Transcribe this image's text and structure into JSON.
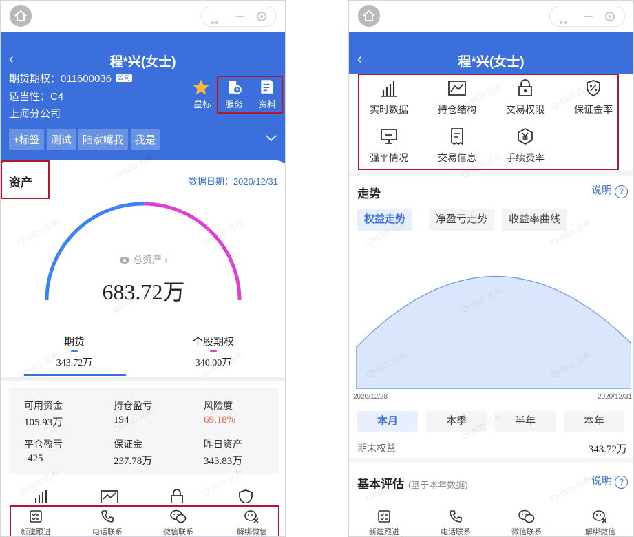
{
  "customer": {
    "title": "程*兴(女士)",
    "account_label": "期货期权：",
    "account_no": "011600036",
    "company_badge": "公司",
    "suitability": "适当性：C4",
    "branch": "上海分公司"
  },
  "header_actions": [
    {
      "label": "-星标",
      "icon": "star-icon"
    },
    {
      "label": "服务",
      "icon": "service-icon"
    },
    {
      "label": "资料",
      "icon": "document-icon"
    }
  ],
  "tags": [
    "+标签",
    "测试",
    "陆家嘴我",
    "我是"
  ],
  "assets": {
    "title": "资产",
    "date": "数据日期：2020/12/31",
    "total_label": "总资产",
    "total_value": "683.72万",
    "gauge_share_futures": 0.5027,
    "futures_label": "期货",
    "futures_value": "343.72万",
    "options_label": "个股期权",
    "options_value": "340.00万",
    "metrics": [
      {
        "label": "可用资金",
        "value": "105.93万"
      },
      {
        "label": "持仓盈亏",
        "value": "194"
      },
      {
        "label": "风险度",
        "value": "69.18%"
      },
      {
        "label": "平仓盈亏",
        "value": "-425"
      },
      {
        "label": "保证金",
        "value": "237.78万"
      },
      {
        "label": "昨日资产",
        "value": "343.83万"
      }
    ]
  },
  "bottom_nav": [
    {
      "label": "新建跟进",
      "icon": "followup-icon"
    },
    {
      "label": "电话联系",
      "icon": "phone-icon"
    },
    {
      "label": "微信联系",
      "icon": "wechat-icon"
    },
    {
      "label": "解绑微信",
      "icon": "wechat-unbind-icon"
    }
  ],
  "grid": [
    {
      "label": "实时数据",
      "icon": "bar-chart-icon"
    },
    {
      "label": "持仓结构",
      "icon": "line-chart-icon"
    },
    {
      "label": "交易权限",
      "icon": "lock-icon"
    },
    {
      "label": "保证金率",
      "icon": "percent-shield-icon"
    },
    {
      "label": "强平情况",
      "icon": "monitor-icon"
    },
    {
      "label": "交易信息",
      "icon": "receipt-icon"
    },
    {
      "label": "手续费率",
      "icon": "yuan-icon"
    }
  ],
  "trend": {
    "title": "走势",
    "explain": "说明",
    "tabs": [
      "权益走势",
      "净盈亏走势",
      "收益率曲线"
    ],
    "start_date": "2020/12/28",
    "end_date": "2020/12/31",
    "periods": [
      "本月",
      "本季",
      "半年",
      "本年"
    ],
    "end_equity_label": "期末权益",
    "end_equity_value": "343.72万"
  },
  "evaluation": {
    "title": "基本评估",
    "subtitle": "(基于本年数据)",
    "explain": "说明"
  },
  "watermark": "QH005 吕布",
  "colors": {
    "primary": "#3b6fdc",
    "magenta": "#e040d0",
    "risk_red": "#ee5a3c",
    "highlight": "#b3172e"
  }
}
